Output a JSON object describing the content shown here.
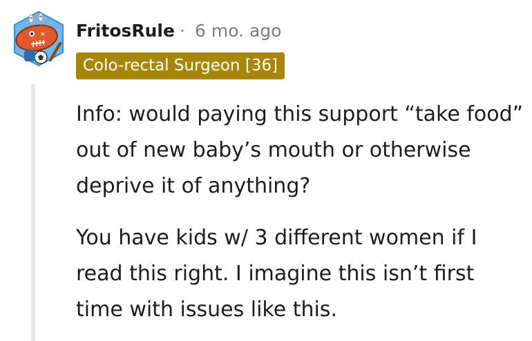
{
  "comment": {
    "username": "FritosRule",
    "separator": "·",
    "timestamp": "6 mo. ago",
    "flair": "Colo-rectal Surgeon [36]",
    "paragraphs": [
      "Info: would paying this support “take food” out of new baby’s mouth or otherwise deprive it of anything?",
      "You have kids w/ 3 different women if I read this right. I imagine this isn’t first time with issues like this."
    ]
  },
  "colors": {
    "flair_background": "#a8860a",
    "username": "#1c1c1c",
    "meta": "#7c7c7c",
    "thread_line": "#e6e7ea"
  },
  "icons": {
    "avatar": "snoo-avatar-icon"
  }
}
